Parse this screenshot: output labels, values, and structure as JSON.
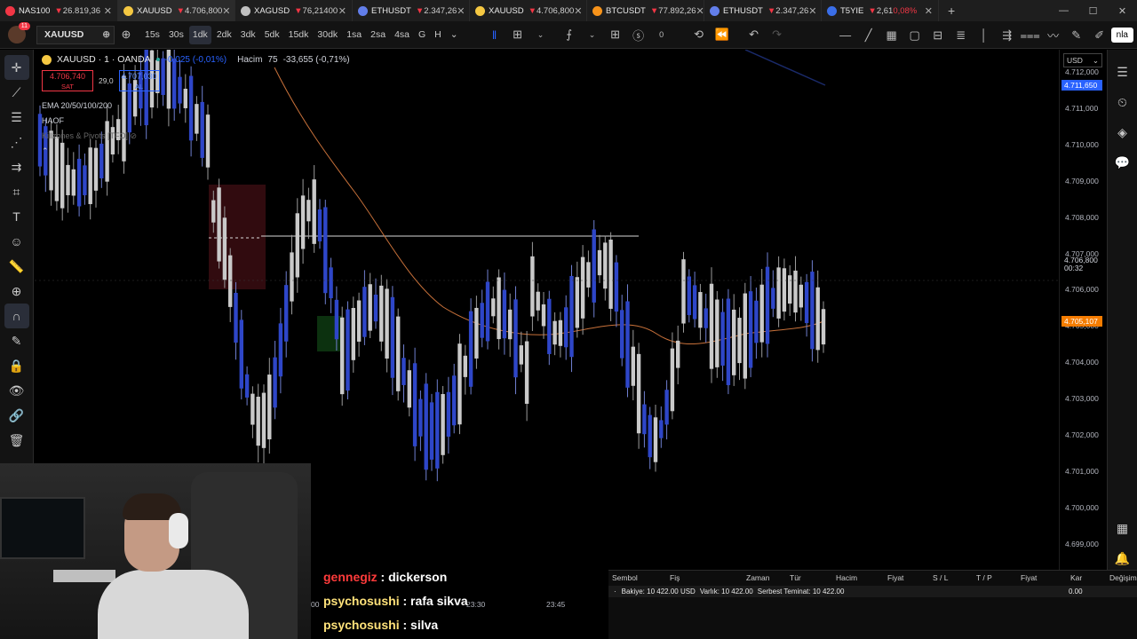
{
  "browser": {
    "tabs": [
      {
        "symbol": "NAS100",
        "price": "26.819,36",
        "color": "#f23645",
        "active": false
      },
      {
        "symbol": "XAUUSD",
        "price": "4.706,800",
        "color": "#f5c842",
        "active": true
      },
      {
        "symbol": "XAGUSD",
        "price": "76,21400",
        "color": "#c0c0c0",
        "active": false
      },
      {
        "symbol": "ETHUSDT",
        "price": "2.347,26",
        "color": "#627eea",
        "active": false
      },
      {
        "symbol": "XAUUSD",
        "price": "4.706,800",
        "color": "#f5c842",
        "active": false
      },
      {
        "symbol": "BTCUSDT",
        "price": "77.892,26",
        "color": "#f7931a",
        "active": false
      },
      {
        "symbol": "ETHUSDT",
        "price": "2.347,26",
        "color": "#627eea",
        "active": false
      },
      {
        "symbol": "T5YIE",
        "price": "2,61",
        "change": "0,08%",
        "color": "#3a6ee8",
        "active": false
      }
    ]
  },
  "toolbar": {
    "notifications": "11",
    "symbol": "XAUUSD",
    "intervals": [
      "15s",
      "30s",
      "1dk",
      "2dk",
      "3dk",
      "5dk",
      "15dk",
      "30dk",
      "1sa",
      "2sa",
      "4sa",
      "G",
      "H"
    ],
    "selected_interval": "1dk",
    "alerts_count": "0",
    "publish": "nla"
  },
  "legend": {
    "title": "XAUUSD · 1 · OANDA",
    "change": "-0,025 (-0,01%)",
    "volume_label": "Hacim",
    "volume_value": "75",
    "volume_change": "-33,655 (-0,71%)",
    "sell_price": "4.706,740",
    "sell_label": "SAT",
    "spread": "29,0",
    "buy_price": "4.707,030",
    "buy_label": "AL",
    "indicator1": "EMA 20/50/100/200",
    "indicator2": "HAOF",
    "indicator3": "Killzones & Pivots [TFO]"
  },
  "price_axis": {
    "currency": "USD",
    "ticks": [
      "4.712,000",
      "4.711,000",
      "4.710,000",
      "4.709,000",
      "4.708,000",
      "4.707,000",
      "4.706,000",
      "4.705,000",
      "4.704,000",
      "4.703,000",
      "4.702,000",
      "4.701,000",
      "4.700,000",
      "4.699,000"
    ],
    "top_label": "4.711,650",
    "current_price": "4.706,800",
    "countdown": "00:32",
    "ema_label": "4.705,107"
  },
  "time_axis": [
    "00",
    "23:30",
    "23:45"
  ],
  "broker": {
    "columns": [
      "Sembol",
      "Fiş",
      "Zaman",
      "Tür",
      "Hacim",
      "Fiyat",
      "S / L",
      "T / P",
      "Fiyat",
      "Kar",
      "Değişim"
    ],
    "balance": "Bakiye: 10 422.00 USD",
    "equity": "Varlık: 10 422.00",
    "free_margin": "Serbest Teminat: 10 422.00",
    "profit": "0.00"
  },
  "chat": [
    {
      "user": "gennegiz",
      "message": "dickerson"
    },
    {
      "user": "psychosushi",
      "message": "rafa sikva"
    },
    {
      "user": "psychosushi",
      "message": "silva"
    }
  ]
}
